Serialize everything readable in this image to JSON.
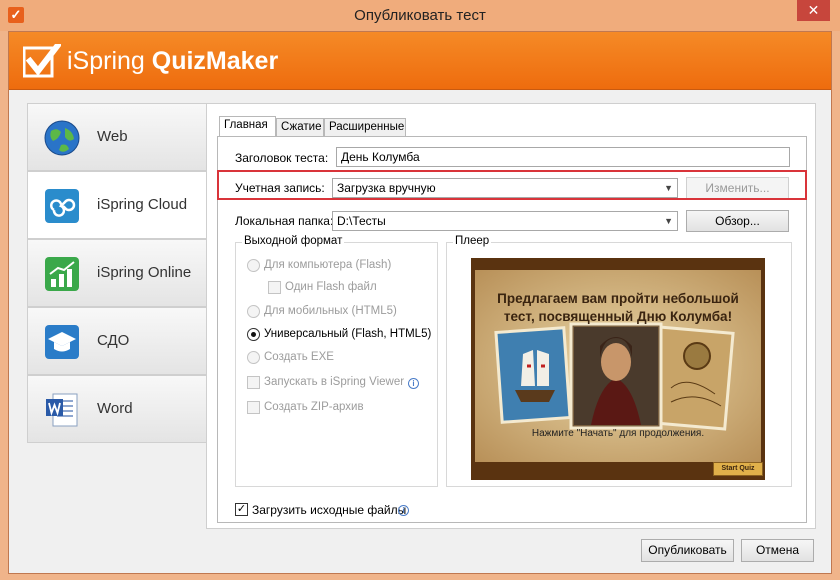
{
  "window": {
    "title": "Опубликовать тест",
    "close_glyph": "✕"
  },
  "banner": {
    "brand_light": "iSpring ",
    "brand_bold": "QuizMaker"
  },
  "sidebar": {
    "items": [
      {
        "label": "Web",
        "icon": "globe-icon"
      },
      {
        "label": "iSpring Cloud",
        "icon": "cloud-icon",
        "active": true
      },
      {
        "label": "iSpring Online",
        "icon": "chart-icon"
      },
      {
        "label": "СДО",
        "icon": "graduation-cap-icon"
      },
      {
        "label": "Word",
        "icon": "word-document-icon"
      }
    ]
  },
  "tabs": [
    "Главная",
    "Сжатие",
    "Расширенные"
  ],
  "form": {
    "title_label": "Заголовок теста:",
    "title_value": "День Колумба",
    "account_label": "Учетная запись:",
    "account_value": "Загрузка вручную",
    "change_button": "Изменить...",
    "folder_label": "Локальная папка:",
    "folder_value": "D:\\Тесты",
    "browse_button": "Обзор..."
  },
  "output_format": {
    "title": "Выходной формат",
    "options": {
      "desktop": "Для компьютера (Flash)",
      "one_flash": "Один Flash файл",
      "mobile": "Для мобильных (HTML5)",
      "universal": "Универсальный (Flash, HTML5)",
      "exe": "Создать EXE",
      "ispring_viewer": "Запускать в iSpring Viewer",
      "zip": "Создать ZIP-архив"
    },
    "selected": "universal"
  },
  "player": {
    "title": "Плеер",
    "slide_title": "Предлагаем вам пройти небольшой тест, посвященный Дню Колумба!",
    "slide_subtitle": "Нажмите \"Начать\" для продолжения.",
    "start_button": "Start Quiz"
  },
  "upload_sources": {
    "label": "Загрузить исходные файлы",
    "checked": true
  },
  "footer": {
    "publish_button": "Опубликовать",
    "cancel_button": "Отмена"
  },
  "colors": {
    "accent": "#ee6c0e",
    "highlight": "#d9343a",
    "titlebar": "#f0ac7c"
  }
}
